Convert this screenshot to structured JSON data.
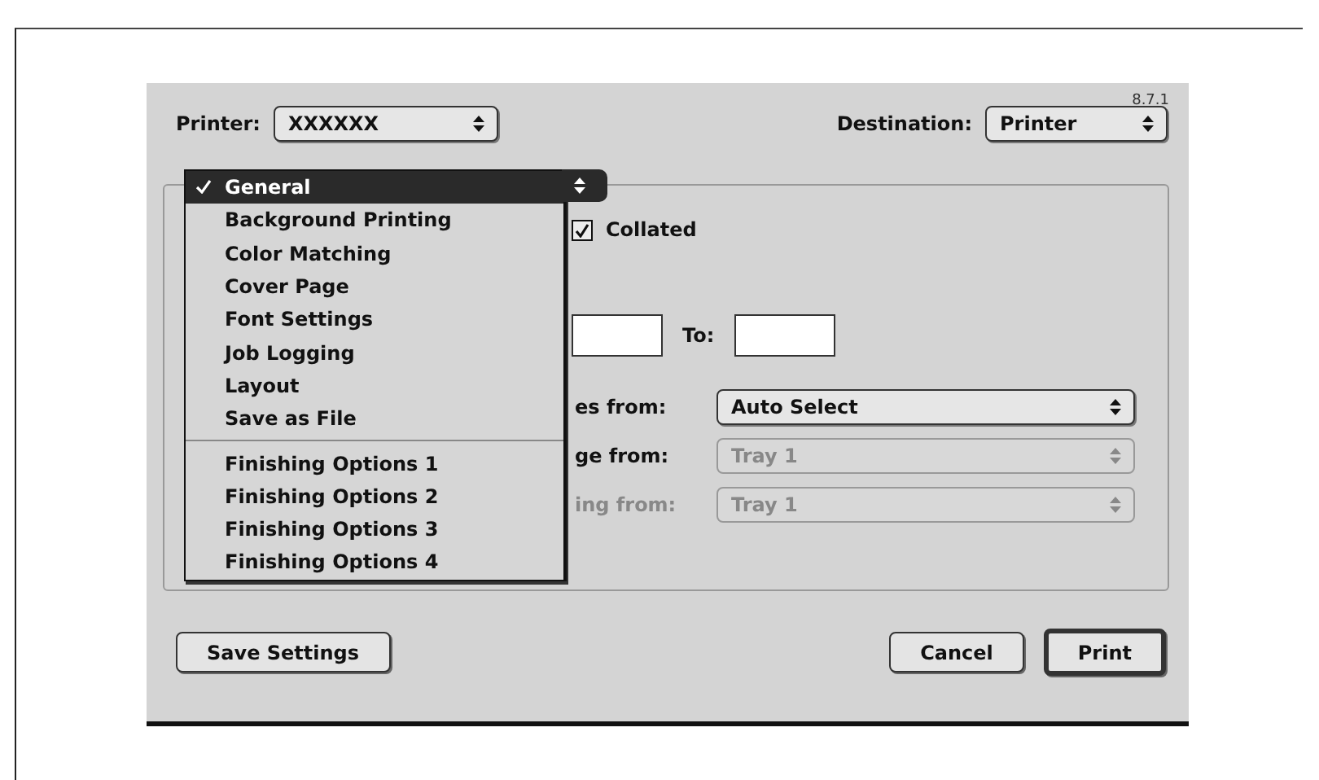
{
  "dialog": {
    "version": "8.7.1",
    "printer": {
      "label": "Printer:",
      "value": "XXXXXX"
    },
    "destination": {
      "label": "Destination:",
      "value": "Printer"
    },
    "panel_menu": {
      "items": [
        {
          "label": "General",
          "selected": true
        },
        {
          "label": "Background Printing",
          "selected": false
        },
        {
          "label": "Color Matching",
          "selected": false
        },
        {
          "label": "Cover Page",
          "selected": false
        },
        {
          "label": "Font Settings",
          "selected": false
        },
        {
          "label": "Job Logging",
          "selected": false
        },
        {
          "label": "Layout",
          "selected": false
        },
        {
          "label": "Save as File",
          "selected": false
        },
        {
          "kind": "separator"
        },
        {
          "label": "Finishing Options 1",
          "selected": false
        },
        {
          "label": "Finishing Options 2",
          "selected": false
        },
        {
          "label": "Finishing Options 3",
          "selected": false
        },
        {
          "label": "Finishing Options 4",
          "selected": false
        }
      ]
    },
    "collated": {
      "label": "Collated",
      "checked": true
    },
    "to_label": "To:",
    "sources": [
      {
        "label": "es from:",
        "value": "Auto Select",
        "disabled": false
      },
      {
        "label": "ge from:",
        "value": "Tray 1",
        "disabled": true
      },
      {
        "label": "ing from:",
        "value": "Tray 1",
        "disabled": true
      }
    ],
    "buttons": [
      {
        "label": "Save Settings",
        "kind": "normal"
      },
      {
        "label": "Cancel",
        "kind": "normal"
      },
      {
        "label": "Print",
        "kind": "default"
      }
    ]
  }
}
